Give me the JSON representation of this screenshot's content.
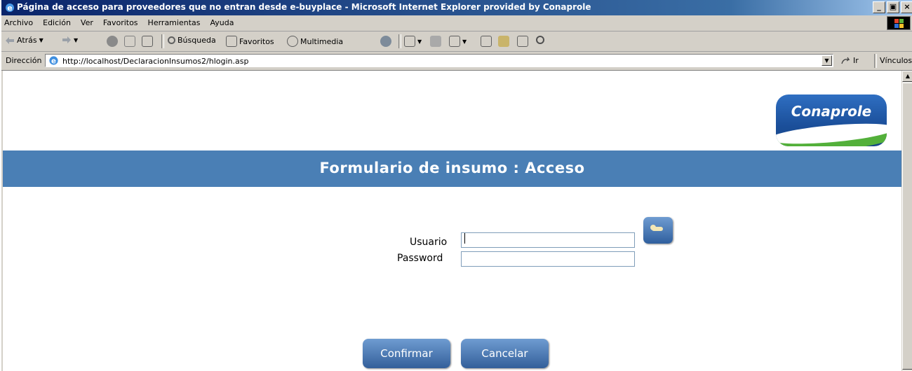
{
  "window": {
    "title": "Página de acceso para proveedores que no entran desde e-buyplace - Microsoft Internet Explorer provided by Conaprole",
    "minimize": "_",
    "maximize": "▣",
    "close": "×"
  },
  "menu": {
    "items": [
      "Archivo",
      "Edición",
      "Ver",
      "Favoritos",
      "Herramientas",
      "Ayuda"
    ]
  },
  "toolbar": {
    "back_label": "Atrás",
    "search_label": "Búsqueda",
    "favorites_label": "Favoritos",
    "multimedia_label": "Multimedia"
  },
  "address": {
    "label": "Dirección",
    "url": "http://localhost/DeclaracionInsumos2/hlogin.asp",
    "go_label": "Ir",
    "links_label": "Vínculos"
  },
  "page": {
    "logo_text": "Conaprole",
    "heading": "Formulario de insumo : Acceso",
    "username_label": "Usuario",
    "username_value": "",
    "password_label": "Password",
    "password_value": "",
    "confirm_label": "Confirmar",
    "cancel_label": "Cancelar"
  },
  "colors": {
    "banner": "#4a7fb5",
    "button": "#3f6fae",
    "brand_green": "#53b03a"
  },
  "icons": [
    "ie-icon",
    "back-arrow-icon",
    "forward-arrow-icon",
    "stop-icon",
    "refresh-icon",
    "home-icon",
    "search-icon",
    "favorites-icon",
    "multimedia-icon",
    "history-icon",
    "mail-icon",
    "print-icon",
    "edit-icon",
    "discuss-icon",
    "messenger-icon",
    "page-icon",
    "go-arrow-icon",
    "key-icon"
  ]
}
